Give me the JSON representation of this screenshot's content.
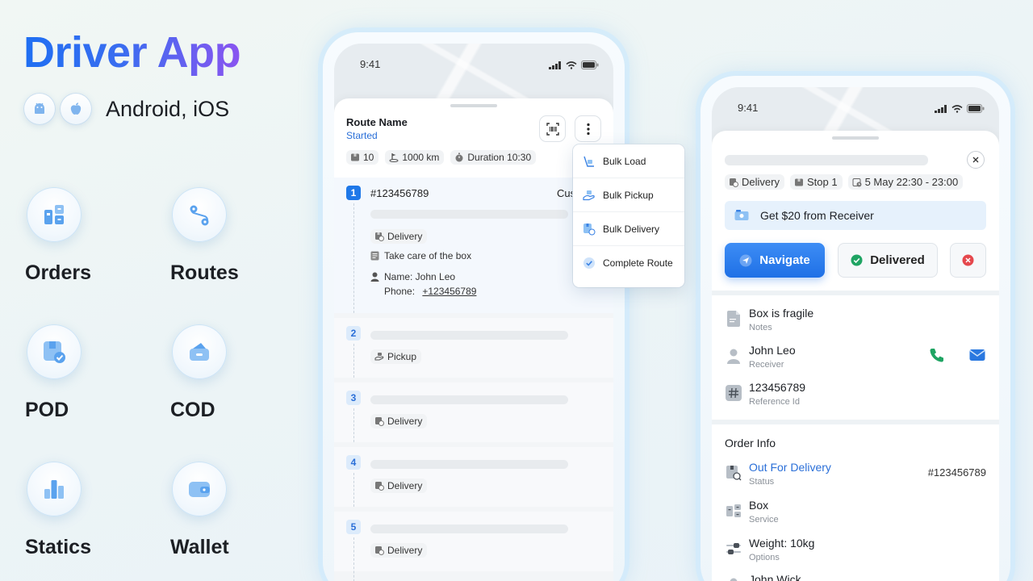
{
  "hero": {
    "title": "Driver App",
    "platforms_text": "Android, iOS"
  },
  "features": [
    {
      "label": "Orders",
      "icon": "orders-icon"
    },
    {
      "label": "Routes",
      "icon": "routes-icon"
    },
    {
      "label": "POD",
      "icon": "pod-icon"
    },
    {
      "label": "COD",
      "icon": "cod-icon"
    },
    {
      "label": "Statics",
      "icon": "statics-icon"
    },
    {
      "label": "Wallet",
      "icon": "wallet-icon"
    }
  ],
  "phone1": {
    "time": "9:41",
    "route_name": "Route Name",
    "route_status": "Started",
    "stats": {
      "count": "10",
      "distance": "1000 km",
      "duration": "Duration 10:30"
    },
    "stops": [
      {
        "num": "1",
        "order": "#123456789",
        "customer_partial": "Cus",
        "type": "Delivery",
        "note": "Take care of the box",
        "name": "Name: John Leo",
        "phone_prefix": "Phone: ",
        "phone": "+123456789"
      },
      {
        "num": "2",
        "type": "Pickup"
      },
      {
        "num": "3",
        "type": "Delivery"
      },
      {
        "num": "4",
        "type": "Delivery"
      },
      {
        "num": "5",
        "type": "Delivery"
      }
    ],
    "menu": [
      "Bulk Load",
      "Bulk Pickup",
      "Bulk Delivery",
      "Complete Route"
    ]
  },
  "phone2": {
    "time": "9:41",
    "chips": {
      "type": "Delivery",
      "stop": "Stop 1",
      "window": "5 May 22:30 - 23:00"
    },
    "promo": "Get $20 from Receiver",
    "navigate": "Navigate",
    "delivered": "Delivered",
    "details": [
      {
        "main": "Box is fragile",
        "sub": "Notes"
      },
      {
        "main": "John Leo",
        "sub": "Receiver"
      },
      {
        "main": "123456789",
        "sub": "Reference Id"
      }
    ],
    "order_info_title": "Order Info",
    "order_info": [
      {
        "main": "Out For Delivery",
        "sub": "Status",
        "right": "#123456789"
      },
      {
        "main": "Box",
        "sub": "Service"
      },
      {
        "main": "Weight: 10kg",
        "sub": "Options"
      },
      {
        "main": "John Wick"
      }
    ]
  },
  "colors": {
    "accent": "#1f70e6",
    "status_blue": "#2a6fd8",
    "success": "#1fa463",
    "danger": "#e5484d",
    "title_gradient_end": "#8a55f0"
  }
}
